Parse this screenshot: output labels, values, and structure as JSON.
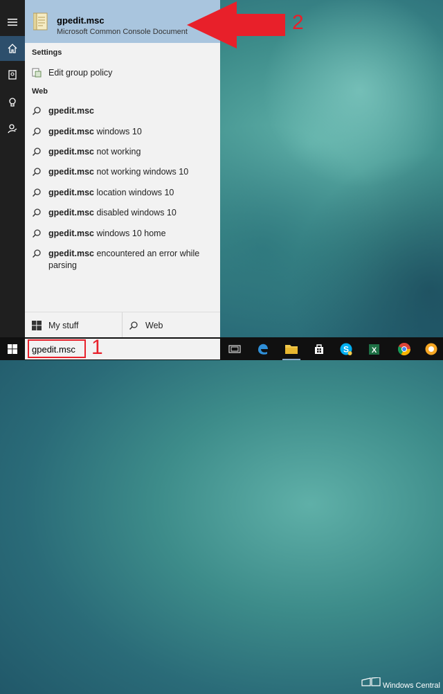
{
  "search": {
    "query": "gpedit.msc",
    "top_hit": {
      "title": "gpedit.msc",
      "subtitle": "Microsoft Common Console Document"
    }
  },
  "sections": {
    "settings": "Settings",
    "web": "Web"
  },
  "settings_items": [
    {
      "label": "Edit group policy"
    }
  ],
  "web_items": [
    {
      "bold": "gpedit.msc",
      "rest": ""
    },
    {
      "bold": "gpedit.msc",
      "rest": " windows 10"
    },
    {
      "bold": "gpedit.msc",
      "rest": " not working"
    },
    {
      "bold": "gpedit.msc",
      "rest": " not working windows 10"
    },
    {
      "bold": "gpedit.msc",
      "rest": " location windows 10"
    },
    {
      "bold": "gpedit.msc",
      "rest": " disabled windows 10"
    },
    {
      "bold": "gpedit.msc",
      "rest": " windows 10 home"
    },
    {
      "bold": "gpedit.msc",
      "rest": " encountered an error while parsing"
    }
  ],
  "bottom": {
    "my_stuff": "My stuff",
    "web": "Web"
  },
  "annotations": {
    "one": "1",
    "two": "2"
  },
  "watermark": "Windows Central",
  "colors": {
    "highlight": "#a9c5de",
    "annotation": "#e8202a",
    "rail": "#1f1f1f",
    "taskbar": "#101010"
  }
}
